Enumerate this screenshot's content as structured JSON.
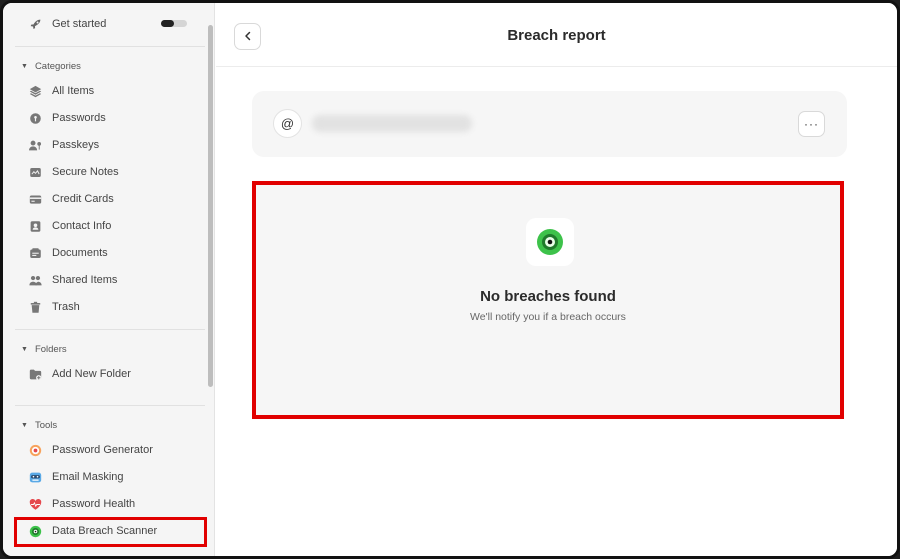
{
  "sidebar": {
    "get_started": "Get started",
    "categories": {
      "title": "Categories",
      "items": [
        {
          "label": "All Items",
          "icon": "layers-icon"
        },
        {
          "label": "Passwords",
          "icon": "key-icon"
        },
        {
          "label": "Passkeys",
          "icon": "passkey-icon"
        },
        {
          "label": "Secure Notes",
          "icon": "note-icon"
        },
        {
          "label": "Credit Cards",
          "icon": "credit-card-icon"
        },
        {
          "label": "Contact Info",
          "icon": "contact-icon"
        },
        {
          "label": "Documents",
          "icon": "document-icon"
        },
        {
          "label": "Shared Items",
          "icon": "people-icon"
        },
        {
          "label": "Trash",
          "icon": "trash-icon"
        }
      ]
    },
    "folders": {
      "title": "Folders",
      "add_label": "Add New Folder"
    },
    "tools": {
      "title": "Tools",
      "items": [
        {
          "label": "Password Generator",
          "icon": "generator-icon"
        },
        {
          "label": "Email Masking",
          "icon": "mask-icon"
        },
        {
          "label": "Password Health",
          "icon": "heart-icon"
        },
        {
          "label": "Data Breach Scanner",
          "icon": "scanner-icon"
        }
      ]
    }
  },
  "main": {
    "title": "Breach report",
    "at_symbol": "@",
    "more_label": "···",
    "result": {
      "title": "No breaches found",
      "subtitle": "We'll notify you if a breach occurs"
    }
  },
  "colors": {
    "highlight": "#e10000",
    "accent_green": "#3dc24a",
    "password_health_red": "#e5484d"
  }
}
